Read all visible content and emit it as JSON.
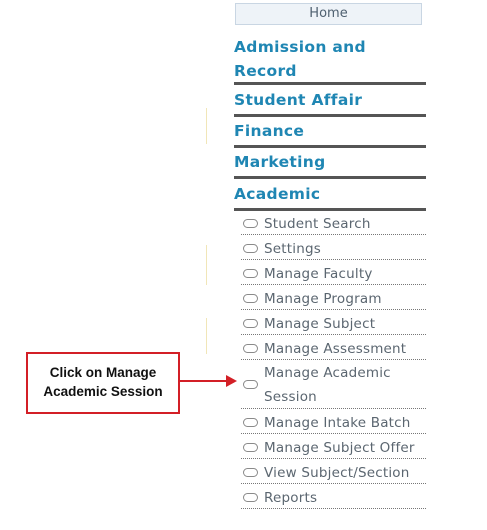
{
  "nav": {
    "home_label": "Home",
    "sections": [
      {
        "label_line1": "Admission and",
        "label_line2": "Record"
      },
      {
        "label": "Student Affair"
      },
      {
        "label": "Finance"
      },
      {
        "label": "Marketing"
      },
      {
        "label": "Academic"
      }
    ],
    "academic_items": [
      {
        "label": "Student Search"
      },
      {
        "label": "Settings"
      },
      {
        "label": "Manage Faculty"
      },
      {
        "label": "Manage Program"
      },
      {
        "label": "Manage Subject"
      },
      {
        "label": "Manage Assessment"
      },
      {
        "label_line1": "Manage Academic",
        "label_line2": "Session"
      },
      {
        "label": "Manage Intake Batch"
      },
      {
        "label": "Manage Subject Offer"
      },
      {
        "label": "View Subject/Section"
      },
      {
        "label": "Reports"
      }
    ]
  },
  "callout": {
    "line1": "Click on Manage",
    "line2": "Academic Session"
  },
  "colors": {
    "section_text": "#1f86b3",
    "callout_border": "#d31f26",
    "item_text": "#5b6670"
  },
  "icons": {
    "bullet": "rounded-bullet-icon",
    "arrow": "arrow-right-icon"
  }
}
